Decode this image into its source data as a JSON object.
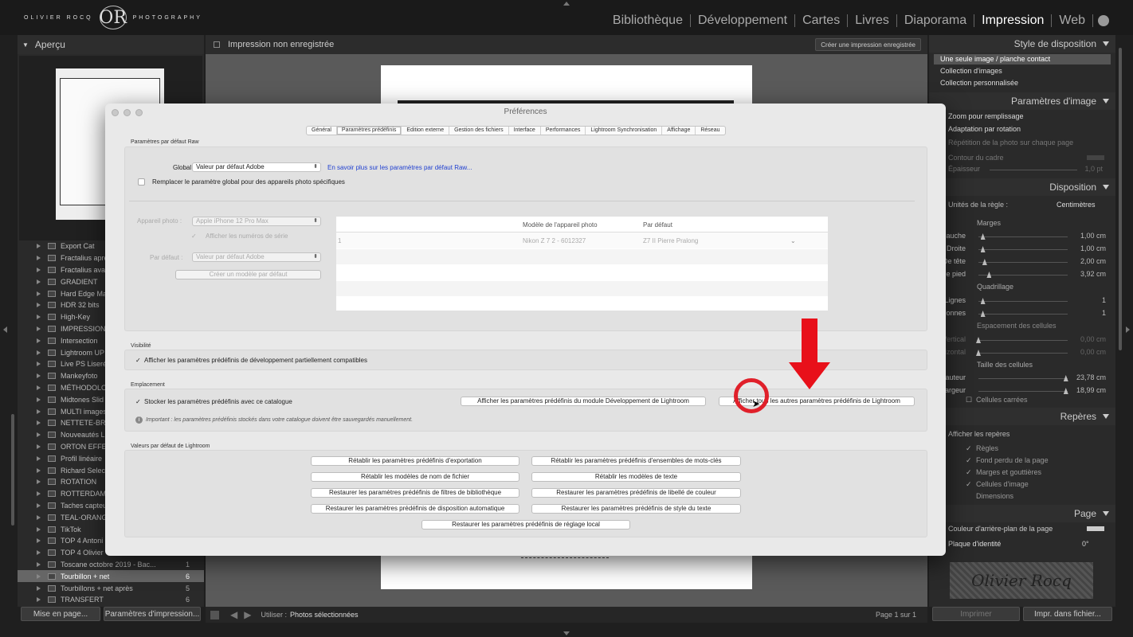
{
  "logo": {
    "left": "OLIVIER ROCQ",
    "mono": "OR",
    "right": "PHOTOGRAPHY"
  },
  "modules": [
    "Bibliothèque",
    "Développement",
    "Cartes",
    "Livres",
    "Diaporama",
    "Impression",
    "Web"
  ],
  "active_module": "Impression",
  "left_panel": {
    "title": "Aperçu",
    "folders": [
      {
        "name": "Export Cat",
        "count": ""
      },
      {
        "name": "Fractalius après",
        "count": ""
      },
      {
        "name": "Fractalius avant",
        "count": ""
      },
      {
        "name": "GRADIENT",
        "count": ""
      },
      {
        "name": "Hard Edge Ma",
        "count": ""
      },
      {
        "name": "HDR 32 bits",
        "count": ""
      },
      {
        "name": "High-Key",
        "count": ""
      },
      {
        "name": "IMPRESSION",
        "count": ""
      },
      {
        "name": "Intersection",
        "count": ""
      },
      {
        "name": "Lightroom UP",
        "count": ""
      },
      {
        "name": "Live PS Liseré",
        "count": ""
      },
      {
        "name": "Mankeyfoto",
        "count": ""
      },
      {
        "name": "MÉTHODOLO",
        "count": ""
      },
      {
        "name": "Midtones Slid",
        "count": ""
      },
      {
        "name": "MULTI images",
        "count": ""
      },
      {
        "name": "NETTETE-BRU",
        "count": ""
      },
      {
        "name": "Nouveautés L",
        "count": ""
      },
      {
        "name": "ORTON EFFEC",
        "count": ""
      },
      {
        "name": "Profil linéaire",
        "count": ""
      },
      {
        "name": "Richard Select",
        "count": ""
      },
      {
        "name": "ROTATION",
        "count": ""
      },
      {
        "name": "ROTTERDAM",
        "count": ""
      },
      {
        "name": "Taches capteu",
        "count": ""
      },
      {
        "name": "TEAL-ORANG",
        "count": ""
      },
      {
        "name": "TikTok",
        "count": ""
      },
      {
        "name": "TOP 4 Antoni",
        "count": ""
      },
      {
        "name": "TOP 4 Olivier",
        "count": ""
      },
      {
        "name": "Toscane octobre 2019 - Bac...",
        "count": "1"
      },
      {
        "name": "Tourbillon + net",
        "count": "6"
      },
      {
        "name": "Tourbillons + net après",
        "count": "5"
      },
      {
        "name": "TRANSFERT",
        "count": "6"
      }
    ],
    "selected_folder": "Tourbillon + net",
    "buttons": {
      "page_setup": "Mise en page...",
      "print_settings": "Paramètres d'impression..."
    }
  },
  "center": {
    "title": "Impression non enregistrée",
    "create_button": "Créer une impression enregistrée",
    "bottom": {
      "use_label": "Utiliser :",
      "use_value": "Photos sélectionnées",
      "page_info": "Page 1 sur 1"
    }
  },
  "right_panel": {
    "layout_style": {
      "header": "Style de disposition",
      "items": [
        "Une seule image / planche contact",
        "Collection d'images",
        "Collection personnalisée"
      ]
    },
    "image_settings": {
      "header": "Paramètres d'image",
      "items": [
        "Zoom pour remplissage",
        "Adaptation par rotation",
        "Répétition de la photo sur chaque page"
      ],
      "border": "Contour du cadre",
      "thickness": "Épaisseur",
      "thickness_value": "1,0 pt"
    },
    "layout": {
      "header": "Disposition",
      "ruler_units_label": "Unités de la règle :",
      "ruler_units": "Centimètres",
      "margins_title": "Marges",
      "margins": [
        {
          "label": "Gauche",
          "value": "1,00 cm"
        },
        {
          "label": "Droite",
          "value": "1,00 cm"
        },
        {
          "label": "De tête",
          "value": "2,00 cm"
        },
        {
          "label": "De pied",
          "value": "3,92 cm"
        }
      ],
      "grid_title": "Quadrillage",
      "grid": [
        {
          "label": "Lignes",
          "value": "1"
        },
        {
          "label": "Colonnes",
          "value": "1"
        }
      ],
      "spacing_title": "Espacement des cellules",
      "spacing": [
        {
          "label": "Vertical",
          "value": "0,00 cm"
        },
        {
          "label": "Horizontal",
          "value": "0,00 cm"
        }
      ],
      "cell_title": "Taille des cellules",
      "cells": [
        {
          "label": "Hauteur",
          "value": "23,78 cm"
        },
        {
          "label": "Largeur",
          "value": "18,99 cm"
        }
      ],
      "square_cells": "Cellules carrées"
    },
    "guides": {
      "header": "Repères",
      "show": "Afficher les repères",
      "items": [
        "Règles",
        "Fond perdu de la page",
        "Marges et gouttières",
        "Cellules d'image",
        "Dimensions"
      ]
    },
    "page": {
      "header": "Page",
      "bg_color": "Couleur d'arrière-plan de la page",
      "identity_plate": "Plaque d'identité",
      "angle": "0°",
      "signature": "Olivier Rocq"
    },
    "buttons": {
      "print": "Imprimer",
      "print_to_file": "Impr. dans fichier..."
    }
  },
  "dialog": {
    "title": "Préférences",
    "tabs": [
      "Général",
      "Paramètres prédéfinis",
      "Edition externe",
      "Gestion des fichiers",
      "Interface",
      "Performances",
      "Lightroom Synchronisation",
      "Affichage",
      "Réseau"
    ],
    "active_tab": "Paramètres prédéfinis",
    "raw": {
      "section": "Paramètres par défaut Raw",
      "global_label": "Global :",
      "global_value": "Valeur par défaut Adobe",
      "learn_more": "En savoir plus sur les paramètres par défaut Raw...",
      "replace_label": "Remplacer le paramètre global pour des appareils photo spécifiques",
      "camera_label": "Appareil photo :",
      "camera_value": "Apple iPhone 12 Pro Max",
      "serial_label": "Afficher les numéros de série",
      "default_label": "Par défaut :",
      "default_value": "Valeur par défaut Adobe",
      "create_default": "Créer un modèle par défaut",
      "table": {
        "headers": [
          "Modèle de l'appareil photo",
          "Par défaut"
        ],
        "row": {
          "index": "1",
          "model": "Nikon Z 7 2 - 6012327",
          "default": "Z7 II Pierre Pralong"
        }
      }
    },
    "visibility": {
      "section": "Visibilité",
      "show_partial": "Afficher les paramètres prédéfinis de développement partiellement compatibles"
    },
    "location": {
      "section": "Emplacement",
      "store_with_catalog": "Stocker les paramètres prédéfinis avec ce catalogue",
      "show_develop": "Afficher les paramètres prédéfinis du module Développement de Lightroom",
      "show_all": "Afficher tous les autres paramètres prédéfinis de Lightroom",
      "note": "Important : les paramètres prédéfinis stockés dans votre catalogue doivent être sauvegardés manuellement."
    },
    "defaults": {
      "section": "Valeurs par défaut de Lightroom",
      "buttons": [
        "Rétablir les paramètres prédéfinis d'exportation",
        "Rétablir les paramètres prédéfinis d'ensembles de mots-clés",
        "Rétablir les modèles de nom de fichier",
        "Rétablir les modèles de texte",
        "Restaurer les paramètres prédéfinis de filtres de bibliothèque",
        "Restaurer les paramètres prédéfinis de libellé de couleur",
        "Restaurer les paramètres prédéfinis de disposition automatique",
        "Restaurer les paramètres prédéfinis de style du texte",
        "Restaurer les paramètres prédéfinis de réglage local"
      ]
    }
  },
  "colors": {
    "accent_red": "#e8101a",
    "link_blue": "#1f3fd0"
  }
}
